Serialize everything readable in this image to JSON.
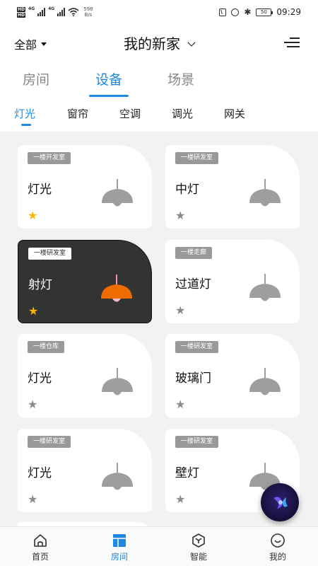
{
  "status_bar": {
    "hd1": "HD",
    "hd2": "HD",
    "gen1": "4G",
    "gen2": "4G",
    "speed_value": "598",
    "speed_unit": "B/s",
    "battery": "50",
    "time": "09:29"
  },
  "header": {
    "filter_label": "全部",
    "home_title": "我的新家"
  },
  "main_tabs": [
    {
      "label": "房间",
      "active": false
    },
    {
      "label": "设备",
      "active": true
    },
    {
      "label": "场景",
      "active": false
    }
  ],
  "sub_tabs": [
    {
      "label": "灯光",
      "active": true
    },
    {
      "label": "窗帘",
      "active": false
    },
    {
      "label": "空调",
      "active": false
    },
    {
      "label": "调光",
      "active": false
    },
    {
      "label": "网关",
      "active": false
    }
  ],
  "devices": [
    {
      "room": "一楼开发室",
      "name": "灯光",
      "favorite": true,
      "on": false
    },
    {
      "room": "一楼研发室",
      "name": "中灯",
      "favorite": false,
      "on": false
    },
    {
      "room": "一楼研发室",
      "name": "射灯",
      "favorite": true,
      "on": true
    },
    {
      "room": "一楼走廊",
      "name": "过道灯",
      "favorite": false,
      "on": false
    },
    {
      "room": "一楼仓库",
      "name": "灯光",
      "favorite": false,
      "on": false
    },
    {
      "room": "一楼研发室",
      "name": "玻璃门",
      "favorite": false,
      "on": false
    },
    {
      "room": "一楼研发室",
      "name": "灯光",
      "favorite": false,
      "on": false
    },
    {
      "room": "一楼研发室",
      "name": "壁灯",
      "favorite": false,
      "on": false
    }
  ],
  "icons": {
    "lamp_off_color": "#9e9e9e",
    "lamp_on_color": "#ef6c00",
    "star_fav_color": "#f5b800",
    "star_color": "#8a8a8a",
    "accent": "#1e88e5"
  },
  "bottom_nav": [
    {
      "label": "首页",
      "icon": "home-icon",
      "active": false
    },
    {
      "label": "房间",
      "icon": "room-icon",
      "active": true
    },
    {
      "label": "智能",
      "icon": "smart-icon",
      "active": false
    },
    {
      "label": "我的",
      "icon": "profile-icon",
      "active": false
    }
  ]
}
